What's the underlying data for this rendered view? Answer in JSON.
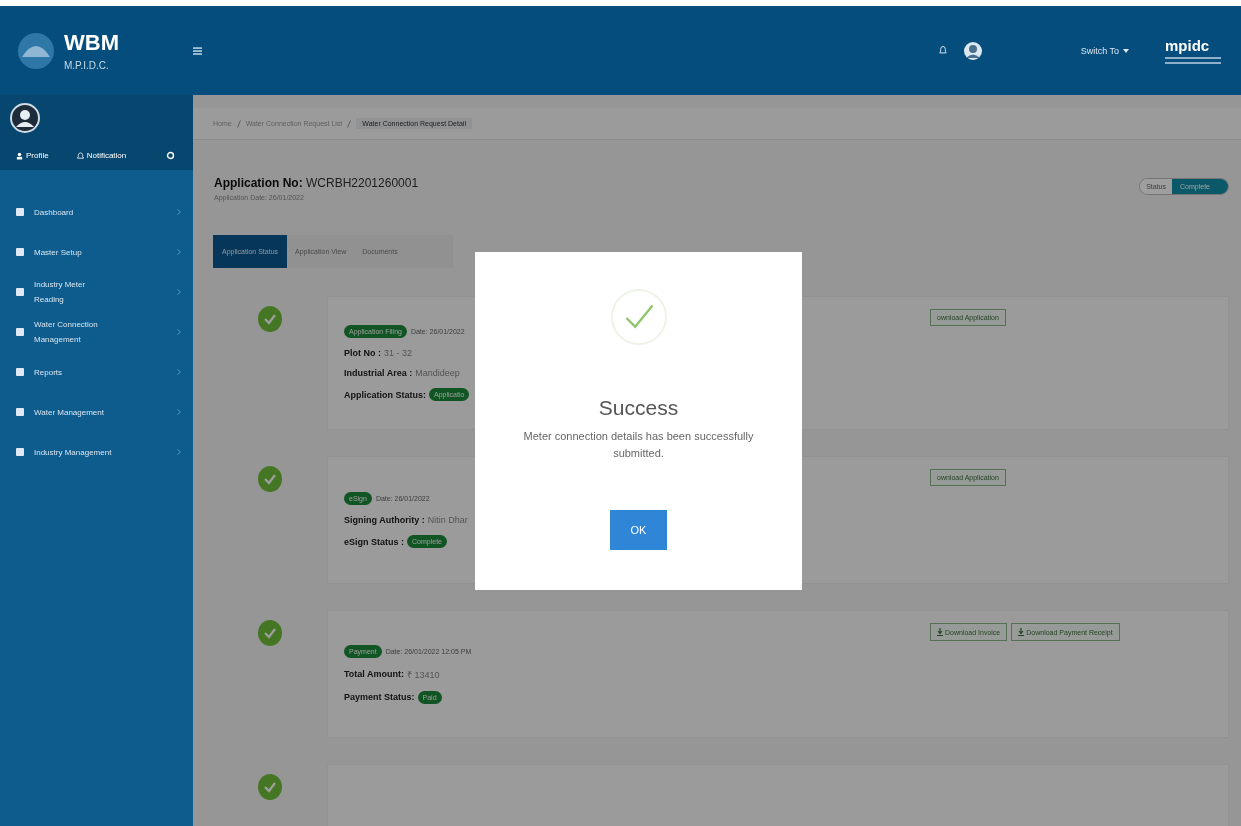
{
  "header": {
    "app_name": "WBM",
    "app_subtitle": "M.P.I.D.C.",
    "switch_label": "Switch To",
    "partner_logo": "mpidc"
  },
  "sidebar": {
    "profile_label": "Profile",
    "notification_label": "Notification",
    "items": [
      {
        "label": "Dashboard"
      },
      {
        "label": "Master Setup"
      },
      {
        "label": "Industry Meter Reading"
      },
      {
        "label": "Water Connection Management"
      },
      {
        "label": "Reports"
      },
      {
        "label": "Water Management"
      },
      {
        "label": "Industry Management"
      }
    ]
  },
  "breadcrumb": [
    {
      "label": "Home",
      "selected": false
    },
    {
      "label": "Water Connection Request List",
      "selected": false
    },
    {
      "label": "Water Connection Request Detail",
      "selected": true
    }
  ],
  "application": {
    "number_label": "Application No:",
    "number": "WCRBH2201260001",
    "date": "Application Date: 26/01/2022"
  },
  "status_toggle": [
    {
      "label": "Status",
      "selected": false
    },
    {
      "label": "Complete",
      "selected": true
    }
  ],
  "tabs": [
    {
      "label": "Application Status",
      "selected": true
    },
    {
      "label": "Application View",
      "selected": false
    },
    {
      "label": "Documents",
      "selected": false
    }
  ],
  "timeline": [
    {
      "done": true,
      "badge": "Application Filing",
      "date": "Date: 26/01/2022",
      "fields": [
        {
          "kind": "text",
          "label": "Plot No :",
          "value": "31 - 32"
        },
        {
          "kind": "text",
          "label": "Industrial Area :",
          "value": "Mandideep"
        },
        {
          "kind": "badge",
          "label": "Application Status:",
          "value": "Applicatio"
        }
      ],
      "buttons": [
        "ownload Application"
      ]
    },
    {
      "done": true,
      "badge": "eSign",
      "date": "Date: 26/01/2022",
      "fields": [
        {
          "kind": "text",
          "label": "Signing Authority :",
          "value": "Nitin Dhar"
        },
        {
          "kind": "badge",
          "label": "eSign Status :",
          "value": "Complete"
        }
      ],
      "buttons": [
        "ownload Application"
      ]
    },
    {
      "done": true,
      "badge": "Payment",
      "date": "Date: 26/01/2022 12:05 PM",
      "fields": [
        {
          "kind": "text",
          "label": "Total Amount:",
          "value": "₹ 13410"
        },
        {
          "kind": "badge",
          "label": "Payment Status:",
          "value": "Paid"
        }
      ],
      "buttons": [
        "Download Invoice",
        "Download Payment Receipt"
      ],
      "button_icons": true
    },
    {
      "done": true
    }
  ],
  "modal": {
    "title": "Success",
    "message": "Meter connection details has been successfully submitted.",
    "button": "OK"
  }
}
